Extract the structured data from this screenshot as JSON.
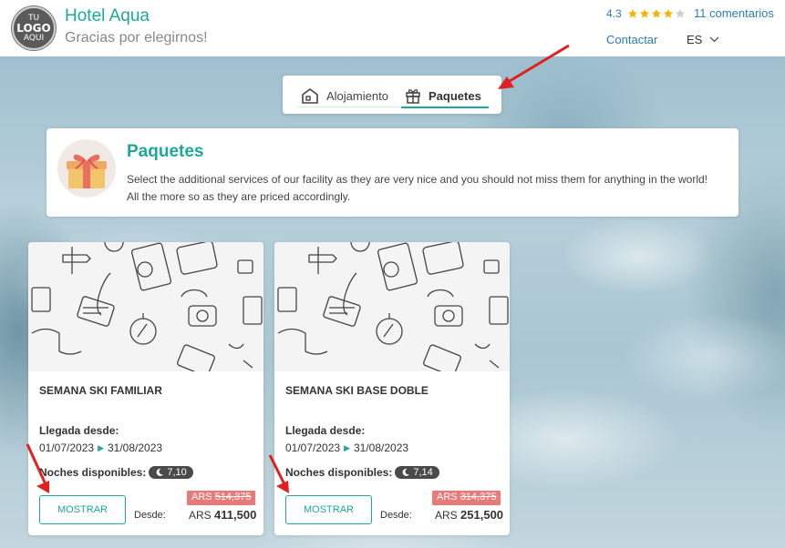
{
  "header": {
    "logo_text": [
      "TU",
      "LOGO",
      "AQUI"
    ],
    "hotel_name": "Hotel Aqua",
    "subtitle": "Gracias por elegirnos!",
    "rating_value": "4.3",
    "rating_stars": 4.3,
    "reviews_link": "11 comentarios",
    "contact_link": "Contactar",
    "language": "ES"
  },
  "tabs": [
    {
      "label": "Alojamiento",
      "icon": "house-icon",
      "active": false
    },
    {
      "label": "Paquetes",
      "icon": "gift-icon",
      "active": true
    }
  ],
  "info": {
    "title": "Paquetes",
    "text": "Select the additional services of our facility as they are very nice and you should not miss them for anything in the world! All the more so as they are priced accordingly."
  },
  "cards": [
    {
      "title": "SEMANA SKI FAMILIAR",
      "arrival_label": "Llegada desde:",
      "date_from": "01/07/2023",
      "date_to": "31/08/2023",
      "nights_label": "Noches disponibles:",
      "nights": "7,10",
      "button": "MOSTRAR",
      "from_label": "Desde:",
      "currency": "ARS",
      "old_price": "514,375",
      "price": "411,500"
    },
    {
      "title": "SEMANA SKI BASE DOBLE",
      "arrival_label": "Llegada desde:",
      "date_from": "01/07/2023",
      "date_to": "31/08/2023",
      "nights_label": "Noches disponibles:",
      "nights": "7,14",
      "button": "MOSTRAR",
      "from_label": "Desde:",
      "currency": "ARS",
      "old_price": "314,375",
      "price": "251,500"
    }
  ],
  "colors": {
    "accent": "#1fa89a",
    "link": "#2a7db8",
    "discount": "#e87a7a",
    "arrow": "#e02020"
  }
}
